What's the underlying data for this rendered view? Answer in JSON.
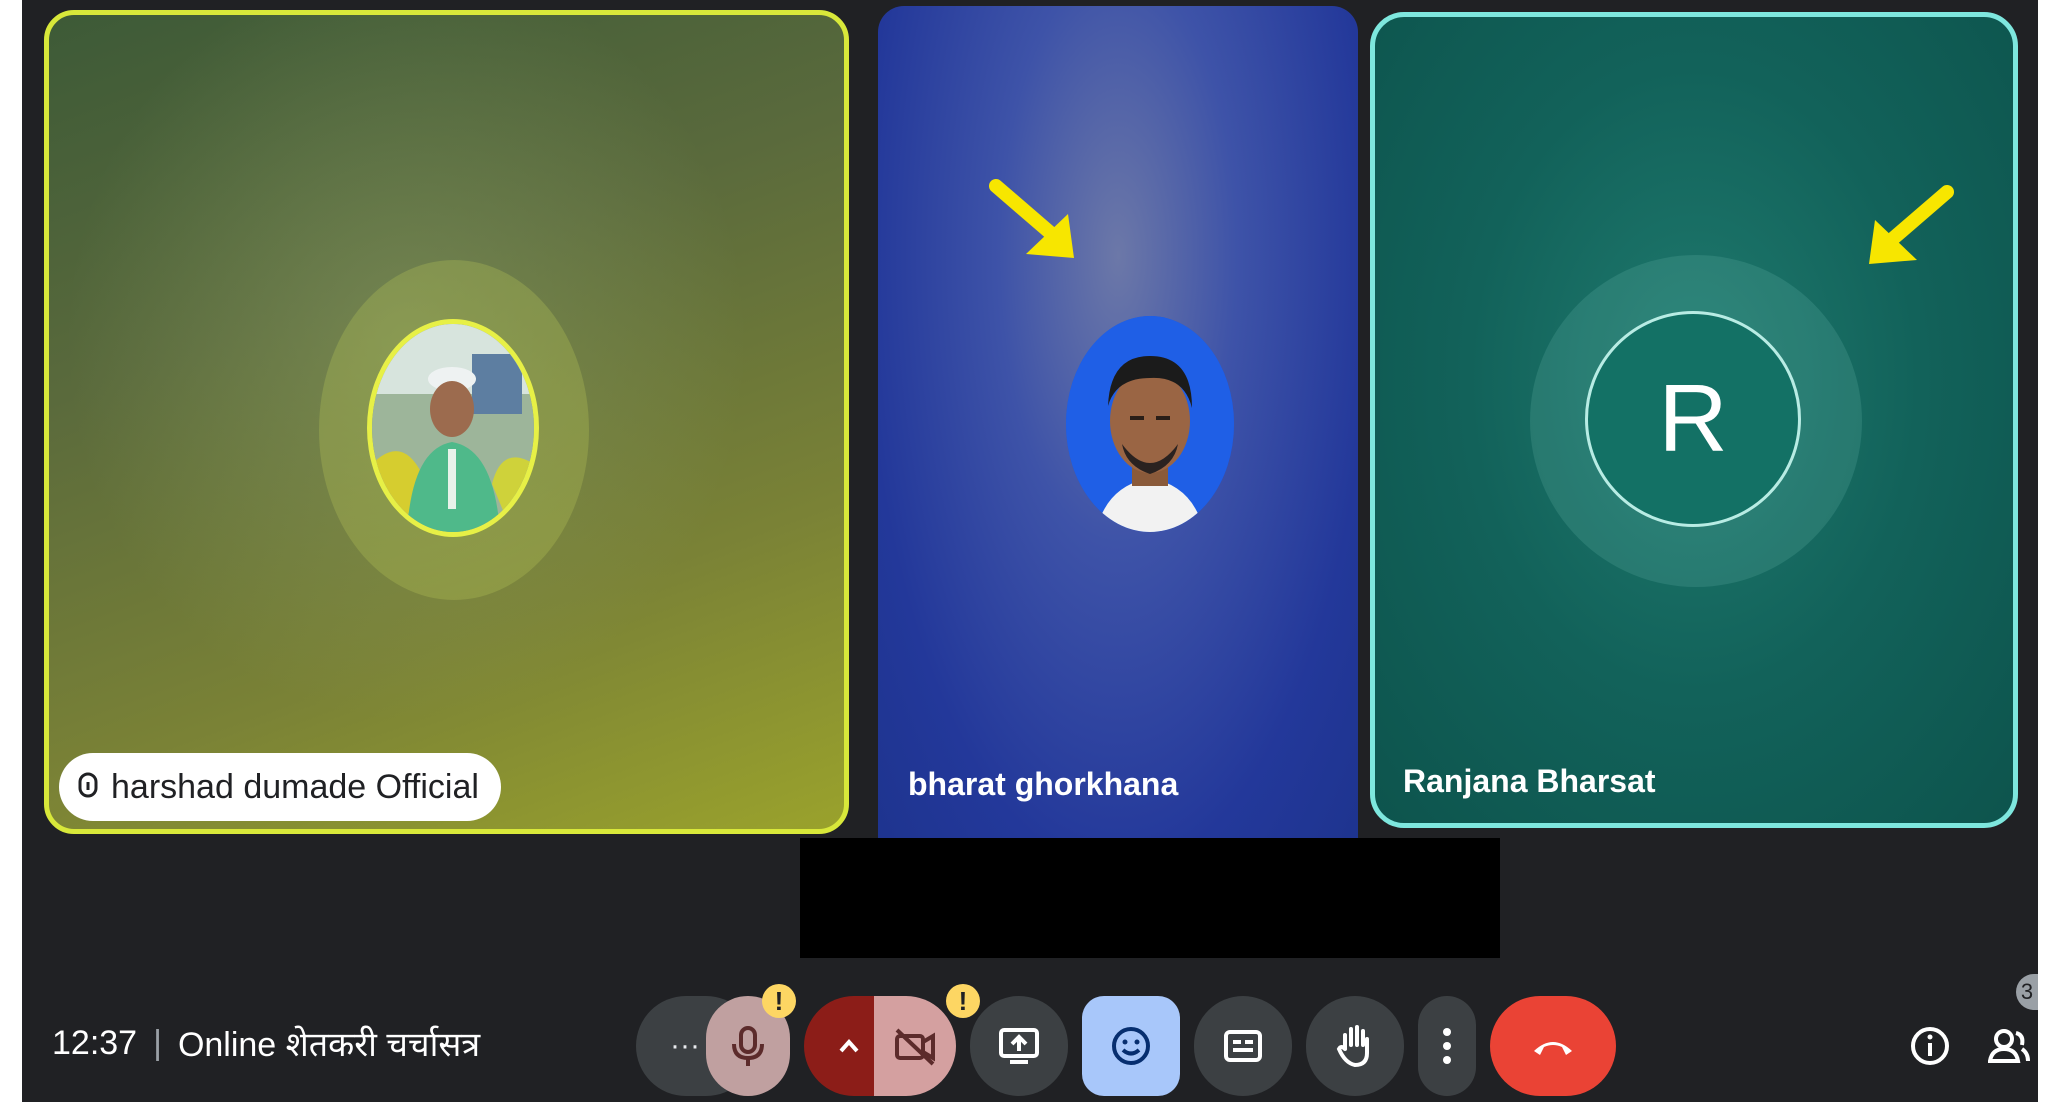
{
  "participants": [
    {
      "id": "harshad",
      "name": "harshad dumade Official",
      "active_speaker": true
    },
    {
      "id": "bharat",
      "name": "bharat ghorkhana",
      "active_speaker": false
    },
    {
      "id": "ranjana",
      "name": "Ranjana Bharsat",
      "initial": "R",
      "active_speaker": false
    }
  ],
  "footer": {
    "time": "12:37",
    "separator": "|",
    "meeting_title": "Online शेतकरी चर्चासत्र"
  },
  "controls": {
    "more_label": "···",
    "mic_warning": "!",
    "camera_warning": "!",
    "people_count_badge": "3"
  },
  "colors": {
    "speaker_border": "#d8e83a",
    "ranjana_border": "#7ee7de",
    "end_call": "#ea4335",
    "emoji_button": "#a8c7fa",
    "arrow": "#f7e600"
  },
  "icons": [
    "microphone-muted-icon",
    "chevron-up-icon",
    "camera-off-icon",
    "present-icon",
    "emoji-icon",
    "captions-icon",
    "raise-hand-icon",
    "more-vert-icon",
    "end-call-icon",
    "info-icon",
    "people-icon"
  ]
}
